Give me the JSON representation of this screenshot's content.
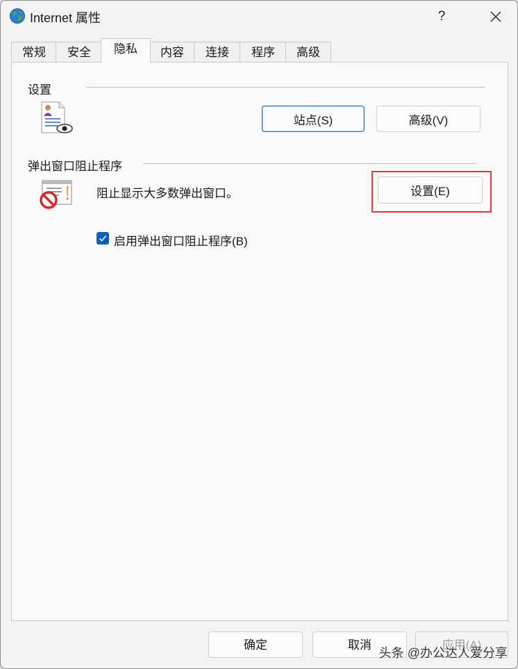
{
  "window": {
    "title": "Internet 属性",
    "help_label": "?",
    "close_icon": "close-icon",
    "app_icon": "globe-icon"
  },
  "tabs": [
    {
      "label": "常规",
      "active": false
    },
    {
      "label": "安全",
      "active": false
    },
    {
      "label": "隐私",
      "active": true
    },
    {
      "label": "内容",
      "active": false
    },
    {
      "label": "连接",
      "active": false
    },
    {
      "label": "程序",
      "active": false
    },
    {
      "label": "高级",
      "active": false
    }
  ],
  "settings_group": {
    "label": "设置",
    "icon": "privacy-document-icon",
    "sites_button": "站点(S)",
    "advanced_button": "高级(V)"
  },
  "popup_group": {
    "label": "弹出窗口阻止程序",
    "icon": "popup-blocker-icon",
    "description": "阻止显示大多数弹出窗口。",
    "settings_button": "设置(E)",
    "checkbox_label": "启用弹出窗口阻止程序(B)",
    "checkbox_checked": true,
    "highlight_color": "#e0393b"
  },
  "footer": {
    "ok_button": "确定",
    "cancel_button": "取消",
    "apply_button": "应用(A)"
  },
  "watermark": "头条 @办公达人爱分享"
}
